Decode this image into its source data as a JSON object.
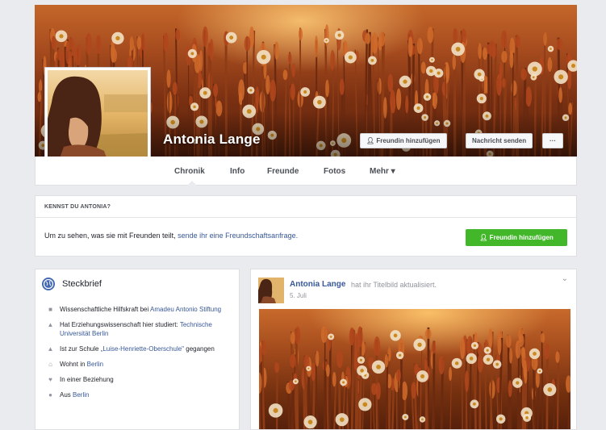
{
  "profile": {
    "name": "Antonia Lange",
    "add_friend_label": "Freundin hinzufügen",
    "message_label": "Nachricht senden",
    "more_label": "···"
  },
  "tabs": [
    {
      "label": "Chronik"
    },
    {
      "label": "Info"
    },
    {
      "label": "Freunde"
    },
    {
      "label": "Fotos"
    },
    {
      "label": "Mehr ▾"
    }
  ],
  "know_box": {
    "title": "KENNST DU ANTONIA?",
    "text": "Um zu sehen, was sie mit Freunden teilt, ",
    "link": "sende ihr eine Freundschaftsanfrage.",
    "button_label": "Freundin hinzufügen"
  },
  "intro": {
    "title": "Steckbrief",
    "items": [
      {
        "icon": "briefcase-icon",
        "text": "Wissenschaftliche Hilfskraft bei ",
        "link": "Amadeu Antonio Stiftung"
      },
      {
        "icon": "graduation-cap-icon",
        "text": "Hat Erziehungswissenschaft hier studiert: ",
        "link": "Technische Universität Berlin"
      },
      {
        "icon": "school-icon",
        "text": "Ist zur Schule ",
        "link": "„Luise-Henriette-Oberschule\"",
        "suffix": " gegangen"
      },
      {
        "icon": "home-icon",
        "text": "Wohnt in ",
        "link": "Berlin"
      },
      {
        "icon": "heart-icon",
        "text": "In einer Beziehung",
        "link": ""
      },
      {
        "icon": "location-pin-icon",
        "text": "Aus ",
        "link": "Berlin"
      }
    ]
  },
  "post": {
    "author": "Antonia Lange",
    "action": "hat ihr Titelbild aktualisiert.",
    "date": "5. Juli",
    "menu": "⌄"
  },
  "colors": {
    "page_bg": "#e9ebee",
    "link": "#385898",
    "green_button": "#42b72a",
    "globe": "#4267b2"
  }
}
